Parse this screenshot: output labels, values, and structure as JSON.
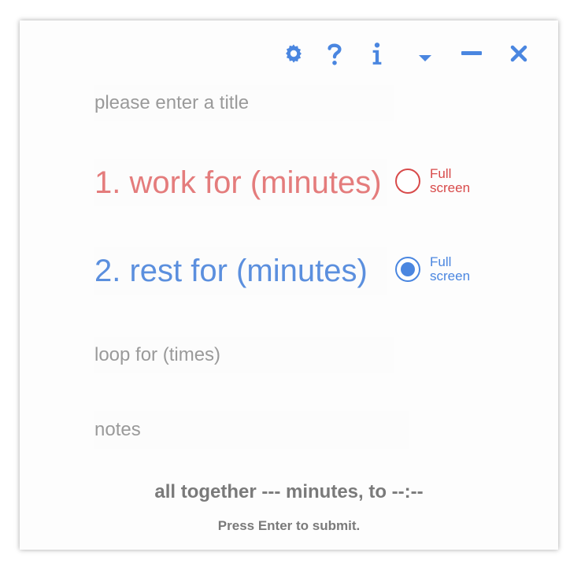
{
  "accent_color": "#4a86e0",
  "work_color": "#e47c7c",
  "titlebar": {
    "buttons": [
      {
        "name": "settings",
        "icon": "gear-icon"
      },
      {
        "name": "help",
        "icon": "question-icon"
      },
      {
        "name": "info",
        "icon": "info-icon"
      },
      {
        "name": "collapse",
        "icon": "caret-down-icon"
      },
      {
        "name": "minimize",
        "icon": "minus-icon"
      },
      {
        "name": "close",
        "icon": "close-icon"
      }
    ]
  },
  "form": {
    "title_placeholder": "please enter a title",
    "work_placeholder": "1. work for (minutes)",
    "rest_placeholder": "2. rest for (minutes)",
    "loop_placeholder": "loop for (times)",
    "notes_placeholder": "notes",
    "work_fullscreen": {
      "line1": "Full",
      "line2": "screen",
      "checked": false
    },
    "rest_fullscreen": {
      "line1": "Full",
      "line2": "screen",
      "checked": true
    }
  },
  "summary": "all together --- minutes, to --:--",
  "hint": "Press Enter to submit."
}
